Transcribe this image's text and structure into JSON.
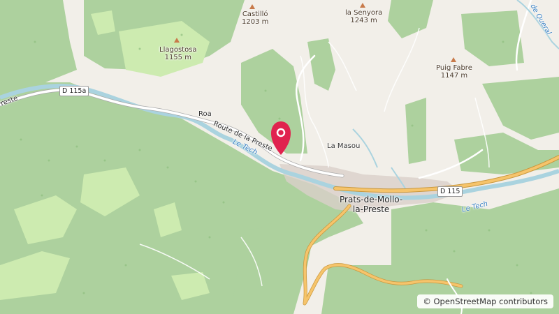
{
  "map": {
    "peaks": [
      {
        "name": "Castilló",
        "elevation": "1203 m"
      },
      {
        "name": "la Senyora",
        "elevation": "1243 m"
      },
      {
        "name": "Llagostosa",
        "elevation": "1155 m"
      },
      {
        "name": "Puig Fabre",
        "elevation": "1147 m"
      }
    ],
    "places": {
      "town": "Prats-de-Mollo-la-Preste",
      "town_line1": "Prats-de-Mollo-",
      "town_line2": "la-Preste",
      "hamlet": "La Masou"
    },
    "roads": {
      "d115a": "D 115a",
      "d115": "D 115",
      "route_preste": "Route de la Preste",
      "route_short": "Roa",
      "left_edge": "Preste"
    },
    "rivers": {
      "tech_1": "Le Tech",
      "tech_2": "Le Tech",
      "top_right": "de Queral"
    },
    "marker": {
      "color": "#e0234e"
    },
    "attribution": "© OpenStreetMap contributors",
    "colors": {
      "forest": "#add19e",
      "meadow": "#cdebb0",
      "land": "#f2efe9",
      "water": "#aad3df",
      "road_major": "#f6c46b"
    }
  }
}
